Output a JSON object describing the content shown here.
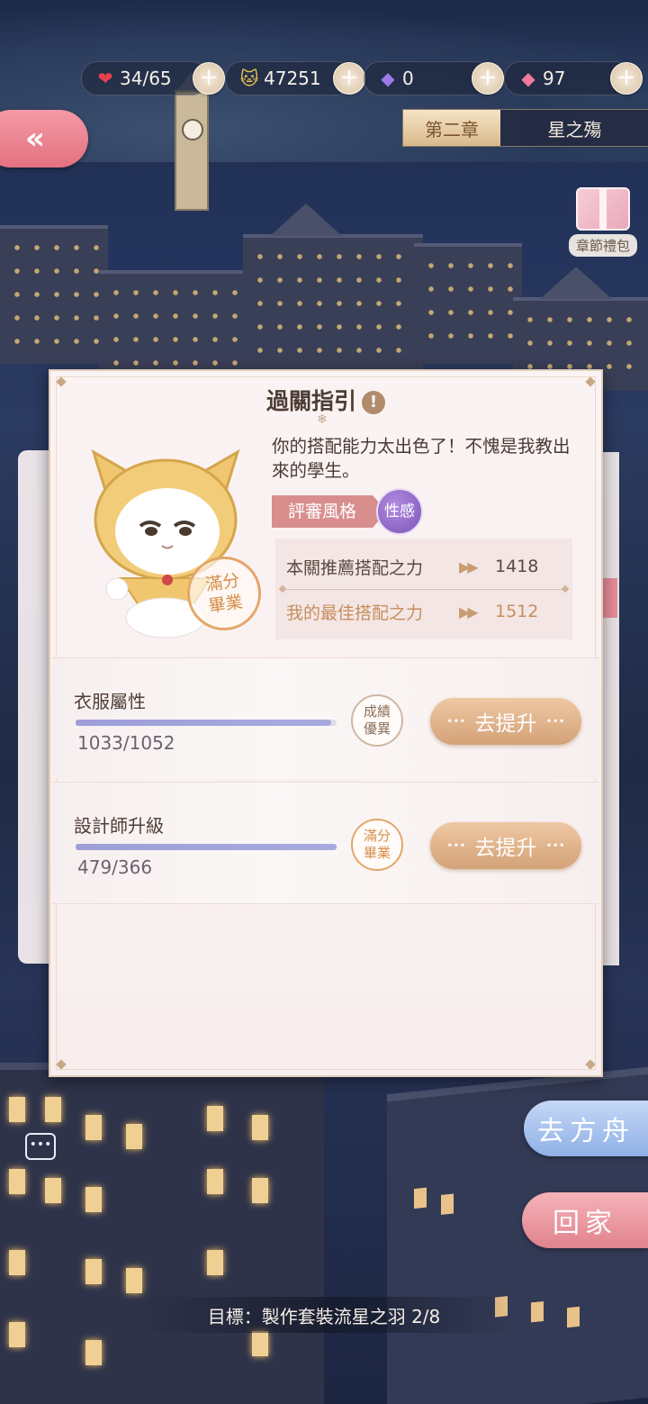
{
  "hud": {
    "hearts": "34/65",
    "coins": "47251",
    "crystal_purple": "0",
    "crystal_pink": "97",
    "plus": "+"
  },
  "back_label": "«",
  "chapter_tabs": [
    {
      "label": "第二章",
      "active": true
    },
    {
      "label": "星之殤",
      "active": false
    }
  ],
  "gift_label": "章節禮包",
  "dialog": {
    "title": "過關指引",
    "info": "!",
    "quote": "你的搭配能力太出色了！不愧是我教出來的學生。",
    "stamp": "滿分畢業",
    "style_label": "評審風格",
    "style_value": "性感",
    "power": {
      "recommended_label": "本關推薦搭配之力",
      "recommended_value": "1418",
      "best_label": "我的最佳搭配之力",
      "best_value": "1512",
      "arrow": "▶▶"
    },
    "tasks": [
      {
        "name": "衣服屬性",
        "value": "1033/1052",
        "progress": 0.98,
        "badge": "成績優異",
        "button": "去提升"
      },
      {
        "name": "設計師升級",
        "value": "479/366",
        "progress": 1.0,
        "badge": "滿分畢業",
        "button": "去提升"
      }
    ]
  },
  "side_buttons": {
    "ark": "去方舟",
    "home": "回家"
  },
  "goal": "目標：製作套裝流星之羽 2/8",
  "colors": {
    "accent_pink": "#e5717f",
    "gold": "#d4a277",
    "progress": "#a8aadf",
    "style_purple": "#7d56b8"
  }
}
